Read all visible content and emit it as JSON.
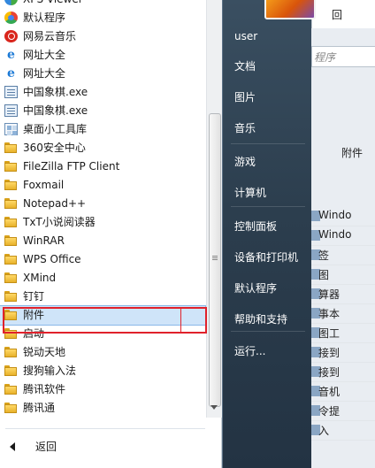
{
  "programs": [
    {
      "label": "XPS Viewer",
      "icon": "xps-viewer-icon"
    },
    {
      "label": "默认程序",
      "icon": "default-programs-icon"
    },
    {
      "label": "网易云音乐",
      "icon": "netease-music-icon"
    },
    {
      "label": "网址大全",
      "icon": "ie-icon"
    },
    {
      "label": "网址大全",
      "icon": "ie-icon"
    },
    {
      "label": "中国象棋.exe",
      "icon": "exe-icon"
    },
    {
      "label": "中国象棋.exe",
      "icon": "exe-icon"
    },
    {
      "label": "桌面小工具库",
      "icon": "gadget-gallery-icon"
    },
    {
      "label": "360安全中心",
      "icon": "folder-icon"
    },
    {
      "label": "FileZilla FTP Client",
      "icon": "folder-icon"
    },
    {
      "label": "Foxmail",
      "icon": "folder-icon"
    },
    {
      "label": "Notepad++",
      "icon": "folder-icon"
    },
    {
      "label": "TxT小说阅读器",
      "icon": "folder-icon"
    },
    {
      "label": "WinRAR",
      "icon": "folder-icon"
    },
    {
      "label": "WPS Office",
      "icon": "folder-icon"
    },
    {
      "label": "XMind",
      "icon": "folder-icon"
    },
    {
      "label": "钉钉",
      "icon": "folder-icon"
    },
    {
      "label": "附件",
      "icon": "folder-icon",
      "selected": true
    },
    {
      "label": "启动",
      "icon": "folder-icon"
    },
    {
      "label": "锐动天地",
      "icon": "folder-icon"
    },
    {
      "label": "搜狗输入法",
      "icon": "folder-icon"
    },
    {
      "label": "腾讯软件",
      "icon": "folder-icon"
    },
    {
      "label": "腾讯通",
      "icon": "folder-icon"
    }
  ],
  "back_label": "返回",
  "right_links": [
    {
      "label": "user",
      "name": "user-link"
    },
    {
      "label": "文档",
      "name": "documents-link"
    },
    {
      "label": "图片",
      "name": "pictures-link"
    },
    {
      "label": "音乐",
      "name": "music-link"
    },
    {
      "label": "游戏",
      "name": "games-link"
    },
    {
      "label": "计算机",
      "name": "computer-link"
    },
    {
      "label": "控制面板",
      "name": "control-panel-link"
    },
    {
      "label": "设备和打印机",
      "name": "devices-printers-link"
    },
    {
      "label": "默认程序",
      "name": "default-programs-link"
    },
    {
      "label": "帮助和支持",
      "name": "help-support-link"
    },
    {
      "label": "运行...",
      "name": "run-link"
    }
  ],
  "background": {
    "title_fragment": "回",
    "search_fragment": "程序",
    "attach_fragment": "附件",
    "list_fragments": [
      "Windo",
      "Windo",
      "签",
      "图",
      "算器",
      "事本",
      "图工",
      "接到",
      "接到",
      "音机",
      "令提",
      "入"
    ]
  },
  "colors": {
    "selection_box": "#e0212b",
    "selected_bg": "#cfe4f9"
  }
}
